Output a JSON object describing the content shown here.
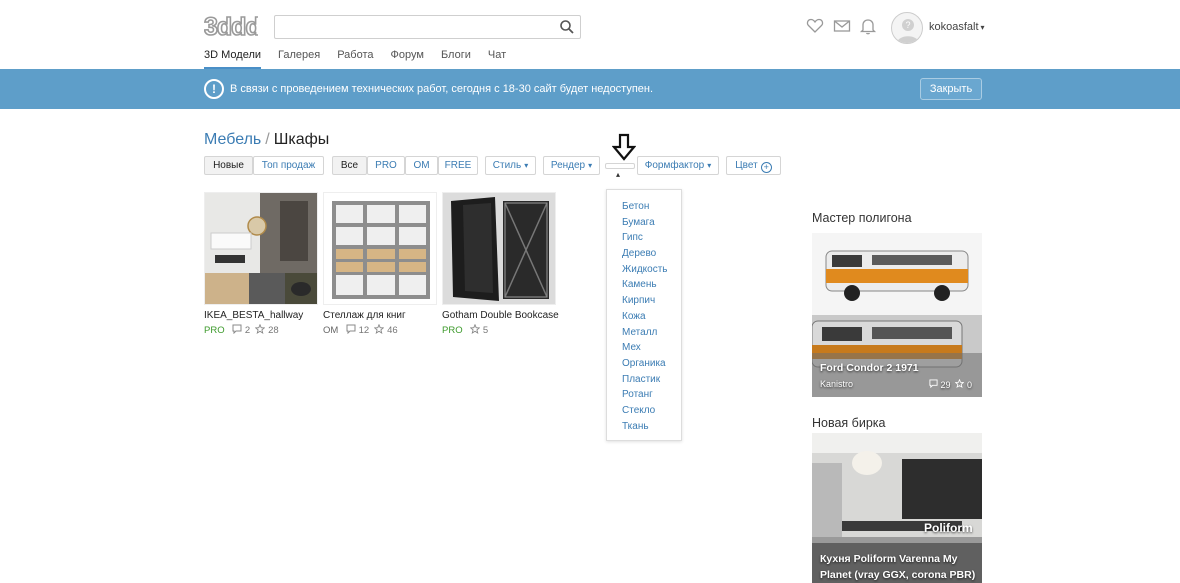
{
  "header": {
    "logo_text": "3ddd",
    "search_placeholder": "",
    "username": "kokoasfalt",
    "nav": [
      "3D Модели",
      "Галерея",
      "Работа",
      "Форум",
      "Блоги",
      "Чат"
    ]
  },
  "banner": {
    "message": "В связи с проведением технических работ, сегодня с 18-30 сайт будет недоступен.",
    "close_label": "Закрыть"
  },
  "breadcrumb": {
    "parent": "Мебель",
    "separator": "/",
    "current": "Шкафы"
  },
  "filters": {
    "sort": [
      "Новые",
      "Топ продаж"
    ],
    "license": [
      "Все",
      "PRO",
      "OM",
      "FREE"
    ],
    "style": "Стиль",
    "render": "Рендер",
    "formfactor": "Формфактор",
    "color": "Цвет"
  },
  "materials": [
    "Бетон",
    "Бумага",
    "Гипс",
    "Дерево",
    "Жидкость",
    "Камень",
    "Кирпич",
    "Кожа",
    "Металл",
    "Мех",
    "Органика",
    "Пластик",
    "Ротанг",
    "Стекло",
    "Ткань"
  ],
  "products": [
    {
      "title": "IKEA_BESTA_hallway",
      "badge": "PRO",
      "comments": "2",
      "favorites": "28"
    },
    {
      "title": "Стеллаж для книг",
      "badge": "OM",
      "comments": "12",
      "favorites": "46"
    },
    {
      "title": "Gotham Double Bookcase",
      "badge": "PRO",
      "comments": "",
      "favorites": "5"
    }
  ],
  "sidebar": {
    "master_heading": "Мастер полигона",
    "master_title": "Ford Condor 2 1971",
    "master_author": "Kanistro",
    "master_comments": "29",
    "master_favorites": "0",
    "new_heading": "Новая бирка",
    "new_title_1": "Кухня Poliform Varenna My",
    "new_title_2": "Planet (vray GGX, corona PBR)",
    "watermark": "Poliform"
  },
  "colors": {
    "banner": "#5e9ec9",
    "link": "#3b7cb3",
    "pro": "#3c9a2b"
  }
}
